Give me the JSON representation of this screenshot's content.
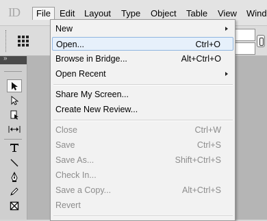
{
  "app": {
    "logo_text": "ID"
  },
  "menubar": {
    "menus": [
      {
        "label": "File"
      },
      {
        "label": "Edit"
      },
      {
        "label": "Layout"
      },
      {
        "label": "Type"
      },
      {
        "label": "Object"
      },
      {
        "label": "Table"
      },
      {
        "label": "View"
      },
      {
        "label": "Windo"
      }
    ]
  },
  "file_menu": {
    "items": [
      {
        "label": "New",
        "shortcut": "",
        "submenu": true,
        "disabled": false
      },
      {
        "label": "Open...",
        "shortcut": "Ctrl+O",
        "submenu": false,
        "disabled": false,
        "highlighted": true
      },
      {
        "label": "Browse in Bridge...",
        "shortcut": "Alt+Ctrl+O",
        "submenu": false,
        "disabled": false
      },
      {
        "label": "Open Recent",
        "shortcut": "",
        "submenu": true,
        "disabled": false
      },
      {
        "label": "Share My Screen...",
        "shortcut": "",
        "submenu": false,
        "disabled": false
      },
      {
        "label": "Create New Review...",
        "shortcut": "",
        "submenu": false,
        "disabled": false
      },
      {
        "label": "Close",
        "shortcut": "Ctrl+W",
        "submenu": false,
        "disabled": true
      },
      {
        "label": "Save",
        "shortcut": "Ctrl+S",
        "submenu": false,
        "disabled": true
      },
      {
        "label": "Save As...",
        "shortcut": "Shift+Ctrl+S",
        "submenu": false,
        "disabled": true
      },
      {
        "label": "Check In...",
        "shortcut": "",
        "submenu": false,
        "disabled": true
      },
      {
        "label": "Save a Copy...",
        "shortcut": "Alt+Ctrl+S",
        "submenu": false,
        "disabled": true
      },
      {
        "label": "Revert",
        "shortcut": "",
        "submenu": false,
        "disabled": true
      }
    ]
  },
  "tools_panel": {
    "collapse_glyph": "»",
    "tools": [
      {
        "name": "selection-tool-icon",
        "selected": true
      },
      {
        "name": "direct-selection-tool-icon",
        "selected": false
      },
      {
        "name": "page-tool-icon",
        "selected": false
      },
      {
        "name": "gap-tool-icon",
        "selected": false
      },
      {
        "name": "type-tool-icon",
        "selected": false
      },
      {
        "name": "line-tool-icon",
        "selected": false
      },
      {
        "name": "pen-tool-icon",
        "selected": false
      },
      {
        "name": "pencil-tool-icon",
        "selected": false
      },
      {
        "name": "rectangle-frame-tool-icon",
        "selected": false
      }
    ]
  },
  "colors": {
    "menu_highlight_bg": "#e6f0fb",
    "menu_highlight_border": "#8fb5e0",
    "disabled_text": "#8c8c8c"
  }
}
